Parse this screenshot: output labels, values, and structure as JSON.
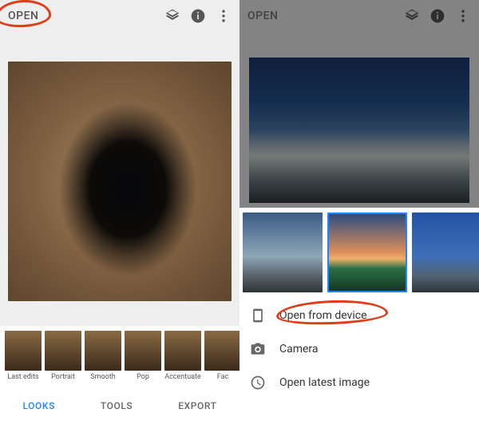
{
  "left": {
    "open_label": "OPEN",
    "filters": [
      {
        "label": "Last edits"
      },
      {
        "label": "Portrait"
      },
      {
        "label": "Smooth"
      },
      {
        "label": "Pop"
      },
      {
        "label": "Accentuate"
      },
      {
        "label": "Fac"
      }
    ],
    "tabs": {
      "looks": "LOOKS",
      "tools": "TOOLS",
      "export": "EXPORT"
    }
  },
  "right": {
    "open_label": "OPEN",
    "menu": {
      "open_device": "Open from device",
      "camera": "Camera",
      "open_latest": "Open latest image"
    }
  }
}
